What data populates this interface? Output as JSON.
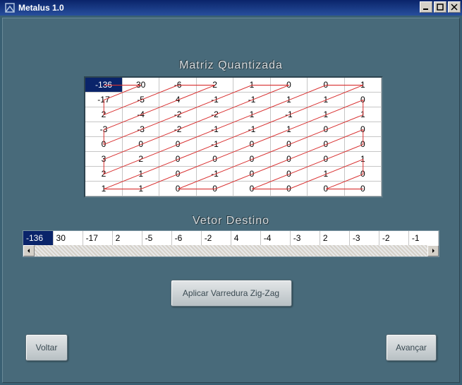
{
  "window": {
    "title": "Metalus 1.0"
  },
  "sections": {
    "matrix_title": "Matriz Quantizada",
    "vector_title": "Vetor Destino"
  },
  "matrix": {
    "selected": [
      0,
      0
    ],
    "rows": [
      [
        -136,
        30,
        -6,
        2,
        1,
        0,
        0,
        1
      ],
      [
        -17,
        -5,
        4,
        -1,
        -1,
        1,
        1,
        0
      ],
      [
        2,
        -4,
        -2,
        -2,
        1,
        -1,
        1,
        1
      ],
      [
        -3,
        -3,
        -2,
        -1,
        -1,
        1,
        0,
        0
      ],
      [
        0,
        0,
        0,
        -1,
        0,
        0,
        0,
        0
      ],
      [
        3,
        2,
        0,
        0,
        0,
        0,
        0,
        1
      ],
      [
        2,
        1,
        0,
        -1,
        0,
        0,
        1,
        0
      ],
      [
        1,
        1,
        0,
        0,
        0,
        0,
        0,
        0
      ]
    ]
  },
  "vector": {
    "selected": 0,
    "values": [
      -136,
      30,
      -17,
      2,
      -5,
      -6,
      -2,
      4,
      -4,
      -3,
      2,
      -3,
      -2,
      -1
    ]
  },
  "buttons": {
    "apply": "Aplicar Varredura Zig-Zag",
    "back": "Voltar",
    "next": "Avançar"
  }
}
